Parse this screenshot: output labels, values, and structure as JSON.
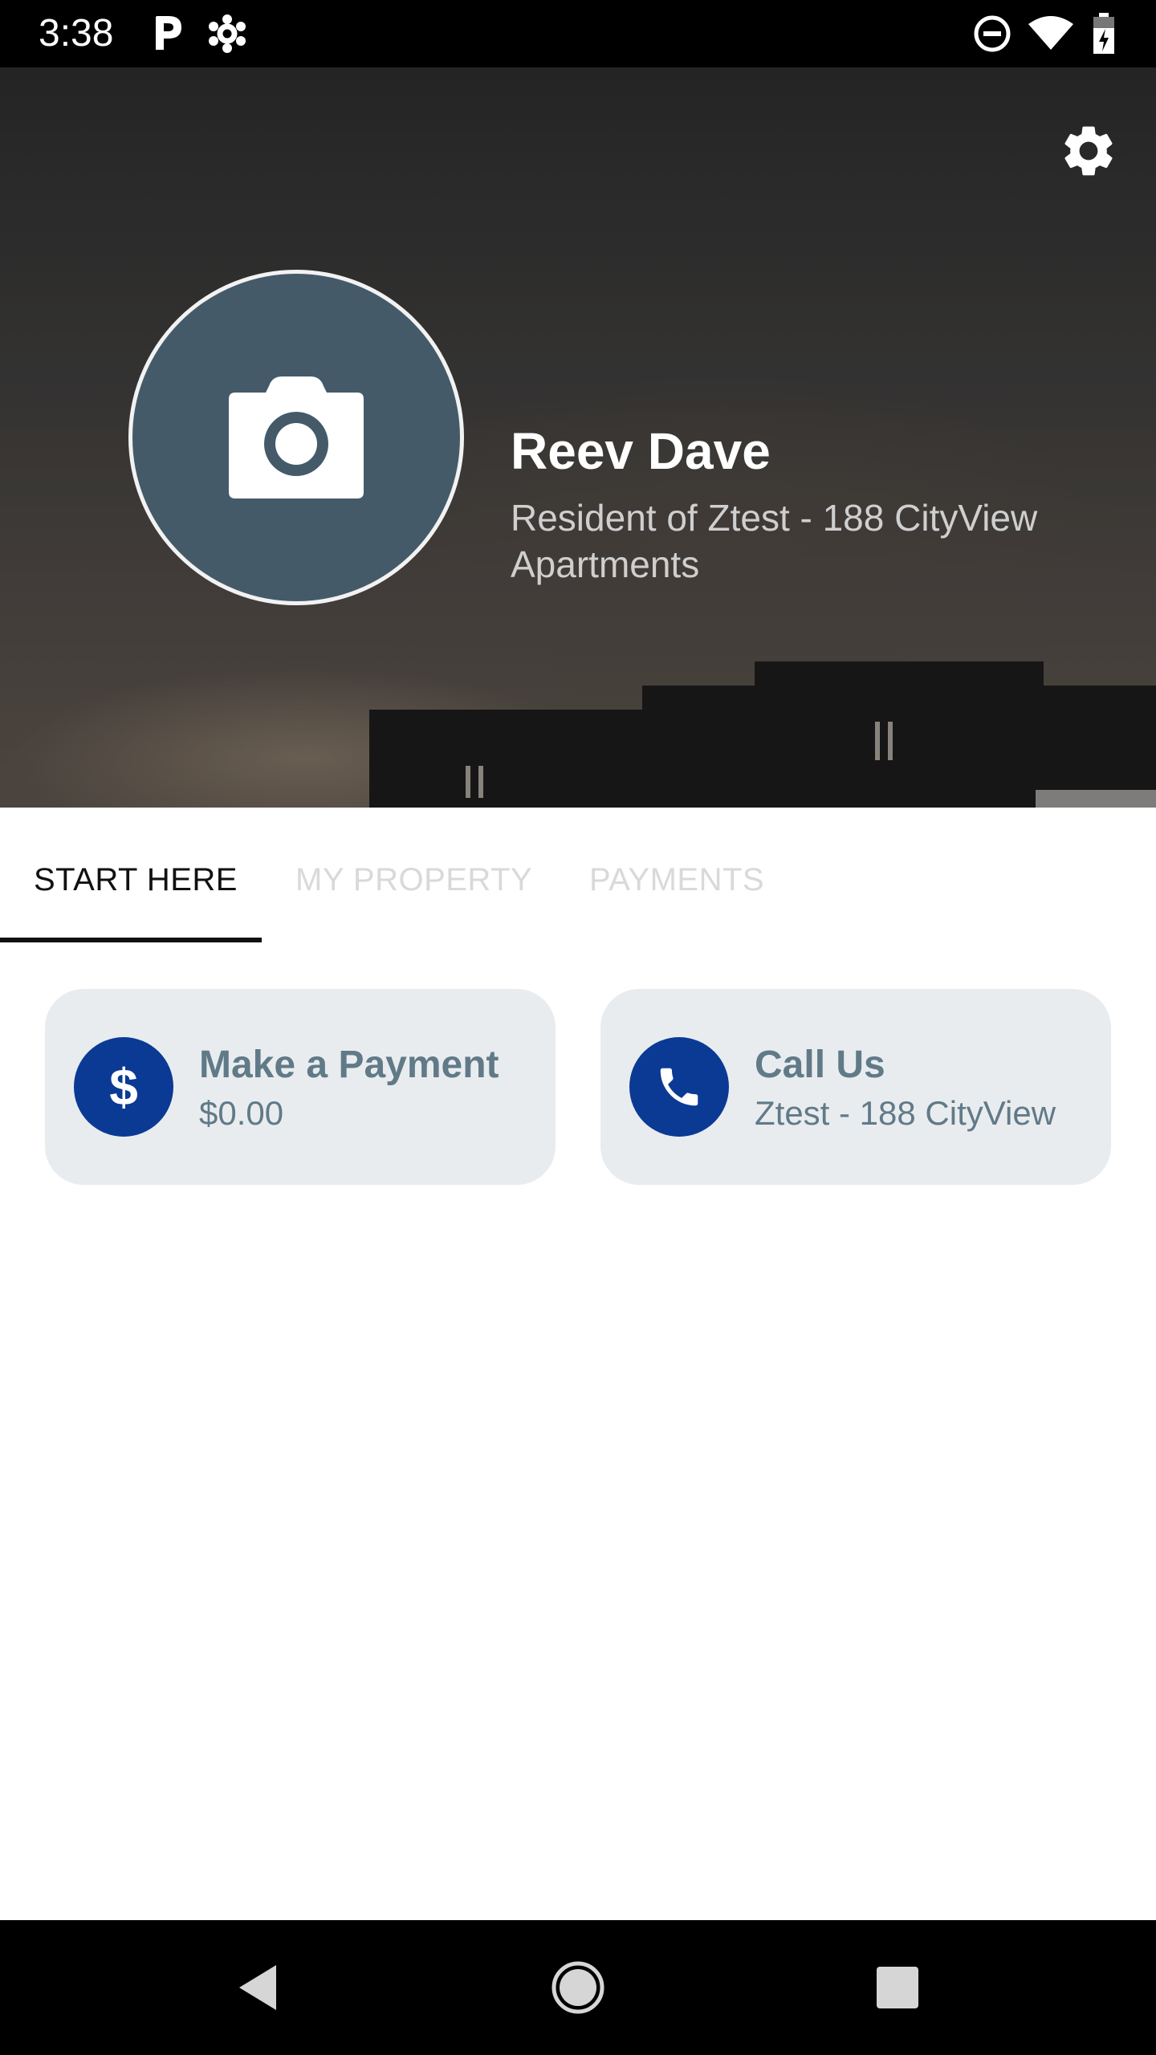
{
  "status_bar": {
    "time": "3:38",
    "icons": [
      "parking-app-icon",
      "settings-cog-icon",
      "do-not-disturb-icon",
      "wifi-icon",
      "battery-charging-icon"
    ]
  },
  "header": {
    "settings_icon": "gear-icon",
    "avatar_icon": "camera-icon",
    "name": "Reev Dave",
    "subtitle": "Resident of Ztest - 188 CityView Apartments"
  },
  "tabs": [
    {
      "label": "START HERE",
      "active": true
    },
    {
      "label": "MY PROPERTY",
      "active": false
    },
    {
      "label": "PAYMENTS",
      "active": false
    }
  ],
  "cards": [
    {
      "title": "Make a Payment",
      "subtitle": "$0.00",
      "icon": "dollar-icon"
    },
    {
      "title": "Call Us",
      "subtitle": "Ztest - 188 CityView",
      "icon": "phone-icon"
    }
  ],
  "nav_bar": {
    "buttons": [
      "back-icon",
      "home-icon",
      "recents-icon"
    ]
  },
  "colors": {
    "accent": "#0b3a95",
    "card_bg": "#e9ecef",
    "card_text": "#617a88",
    "avatar_bg": "#455a69"
  }
}
